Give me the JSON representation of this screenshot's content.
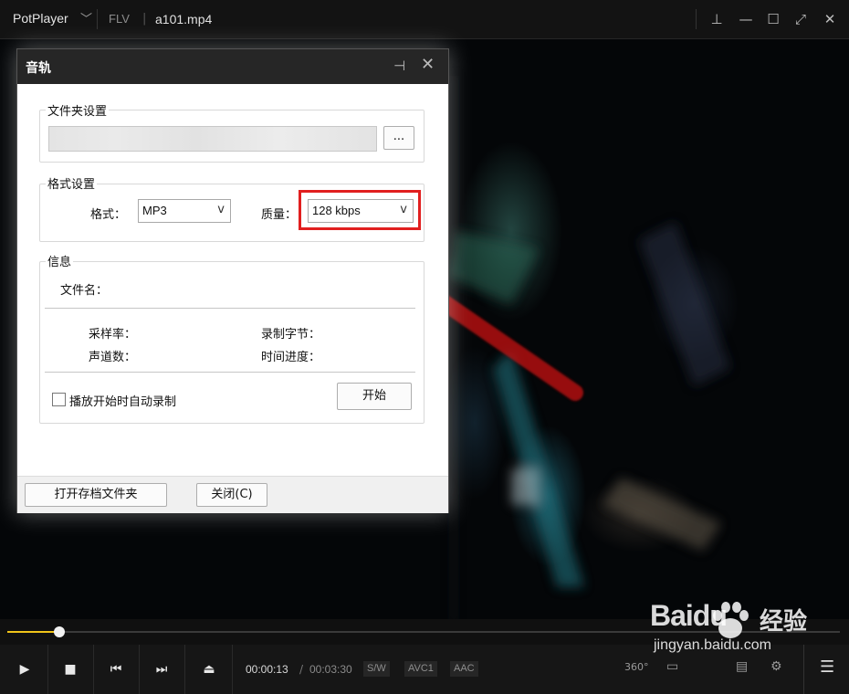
{
  "titlebar": {
    "app_name": "PotPlayer",
    "menu_chevron": "﹀",
    "format": "FLV",
    "separator": "|",
    "filename": "a101.mp4",
    "controls": [
      {
        "icon": "pin-icon",
        "glyph": "⊥"
      },
      {
        "icon": "minimize-icon",
        "glyph": "—"
      },
      {
        "icon": "maximize-icon",
        "glyph": "☐"
      },
      {
        "icon": "fullscreen-icon",
        "glyph": "⤢"
      },
      {
        "icon": "close-icon",
        "glyph": "✕"
      }
    ]
  },
  "dialog": {
    "title": "音轨",
    "folder_group": {
      "label": "文件夹设置",
      "browse_label": "..."
    },
    "format_group": {
      "label": "格式设置",
      "format_label": "格式：",
      "format_value": "MP3",
      "quality_label": "质量：",
      "quality_value": "128 kbps",
      "dropdown_arrow": "v"
    },
    "info_group": {
      "label": "信息",
      "filename_label": "文件名：",
      "samplerate_label": "采样率：",
      "recorded_bytes_label": "录制字节：",
      "channels_label": "声道数：",
      "time_progress_label": "时间进度：",
      "auto_record_label": "播放开始时自动录制",
      "auto_record_checked": false,
      "start_label": "开始"
    },
    "footer": {
      "open_folder_label": "打开存档文件夹",
      "close_label": "关闭(C)"
    }
  },
  "player": {
    "progress_fraction": 0.062,
    "progress_color": "#f0c419",
    "time_current": "00:00:13",
    "time_separator": "/",
    "time_total": "00:03:30",
    "badges": [
      "S/W",
      "AVC1",
      "AAC"
    ],
    "controls": [
      {
        "icon": "play-icon",
        "glyph": "▶"
      },
      {
        "icon": "stop-icon",
        "glyph": "■"
      },
      {
        "icon": "previous-icon",
        "glyph": "⏮"
      },
      {
        "icon": "next-icon",
        "glyph": "⏭"
      },
      {
        "icon": "eject-icon",
        "glyph": "⏏"
      }
    ],
    "right_controls": {
      "vr_label": "360°",
      "menu_glyph": "☰"
    }
  },
  "watermark": {
    "brand": "Baidu",
    "brand_cn": "经验",
    "url": "jingyan.baidu.com"
  },
  "colors": {
    "highlight": "#e11f1f",
    "titlebar_bg": "#131313",
    "controls_bg": "#161616"
  }
}
